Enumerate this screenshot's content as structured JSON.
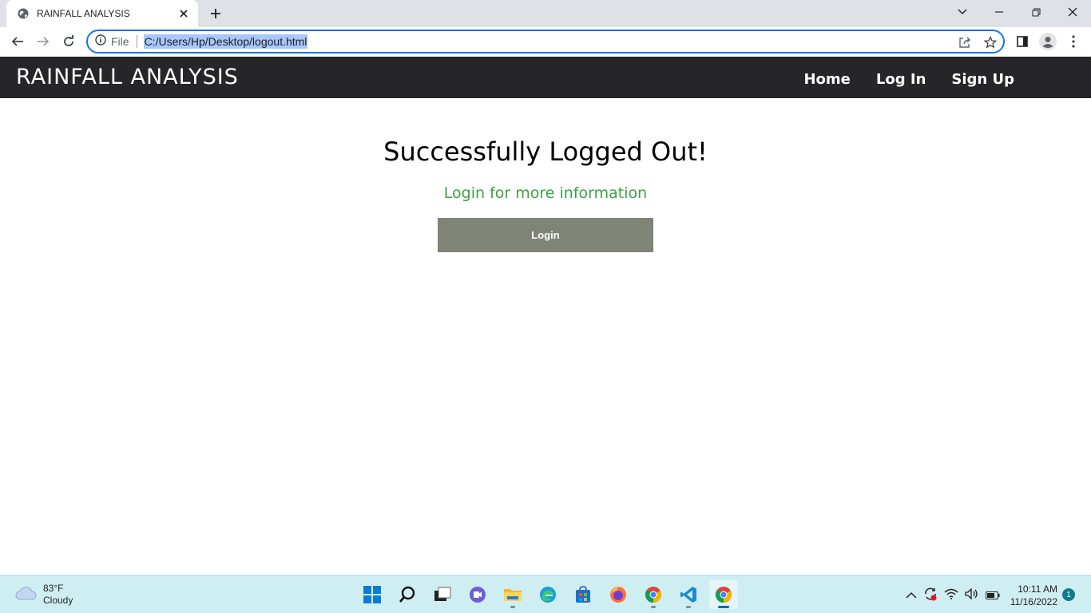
{
  "browser": {
    "tab_title": "RAINFALL ANALYSIS",
    "url_scheme": "File",
    "url": "C:/Users/Hp/Desktop/logout.html"
  },
  "site": {
    "brand": "RAINFALL ANALYSIS",
    "nav": {
      "home": "Home",
      "login": "Log In",
      "signup": "Sign Up"
    }
  },
  "main": {
    "headline": "Successfully Logged Out!",
    "subline": "Login for more information",
    "login_button": "Login"
  },
  "taskbar": {
    "weather_temp": "83°F",
    "weather_desc": "Cloudy",
    "time": "10:11 AM",
    "date": "11/16/2022",
    "notification_count": "1"
  },
  "colors": {
    "navbar_bg": "#262629",
    "accent_green": "#3ea046",
    "button_bg": "#7f8476",
    "url_highlight": "#a8c7fa"
  }
}
